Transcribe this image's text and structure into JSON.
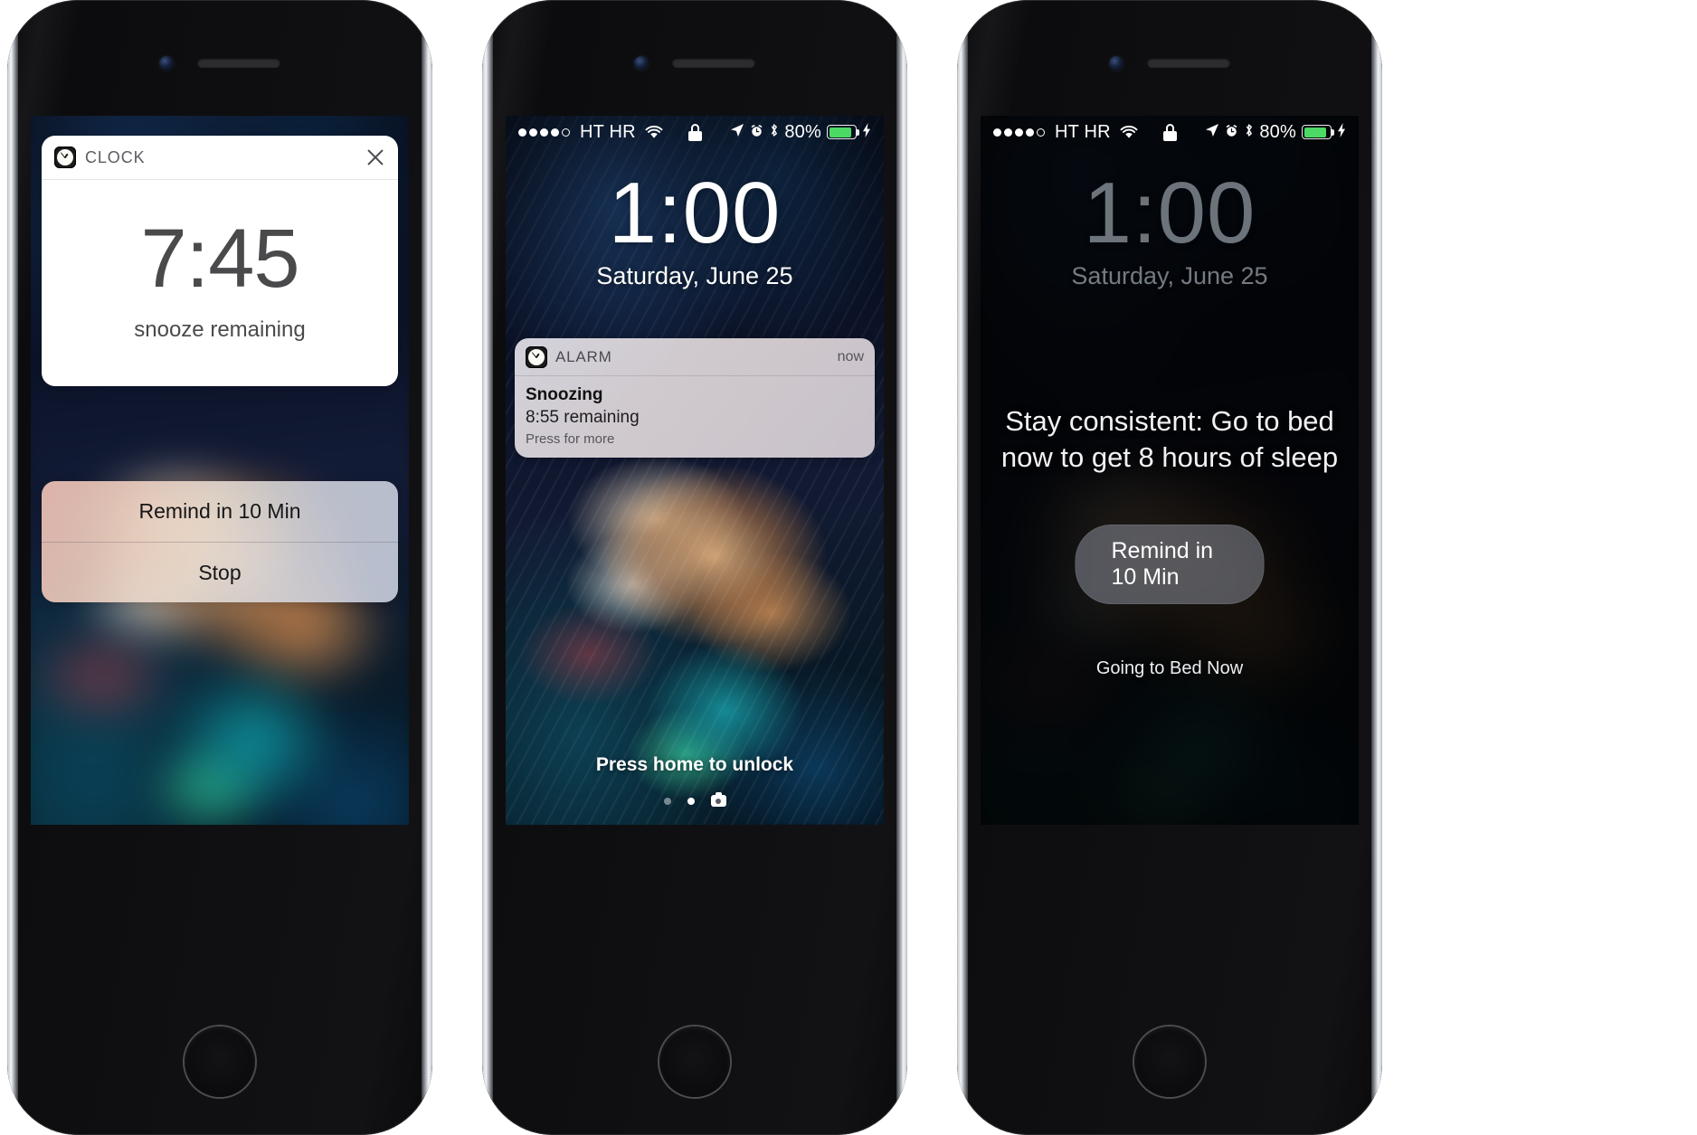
{
  "phones": [
    {
      "id": "phone-left",
      "variant": "expanded-notification",
      "notification_card": {
        "app_label": "CLOCK",
        "app_icon": "clock-icon",
        "close_icon": "close-x-icon",
        "time": "7:45",
        "subtitle": "snooze remaining"
      },
      "actions": [
        {
          "label": "Remind in 10 Min"
        },
        {
          "label": "Stop"
        }
      ]
    },
    {
      "id": "phone-center",
      "variant": "lock-screen-banner",
      "status_bar": {
        "signal_dots_filled": 4,
        "signal_dots_total": 5,
        "carrier": "HT HR",
        "wifi_icon": "wifi-icon",
        "lock_icon": "lock-icon",
        "location_icon": "location-arrow-icon",
        "alarm_icon": "alarm-clock-icon",
        "bluetooth_icon": "bluetooth-icon",
        "battery_percent": "80%",
        "battery_fill": 80,
        "charging_icon": "lightning-bolt-icon",
        "battery_color": "#4cd964"
      },
      "lock": {
        "time": "1:00",
        "date": "Saturday, June 25",
        "unlock_hint": "Press home to unlock"
      },
      "banner": {
        "app_label": "ALARM",
        "app_icon": "clock-icon",
        "timestamp": "now",
        "title": "Snoozing",
        "subtitle": "8:55 remaining",
        "hint": "Press for more"
      },
      "page_dots": {
        "count": 2,
        "active_index": 1,
        "camera_icon": "camera-icon"
      }
    },
    {
      "id": "phone-right",
      "variant": "bedtime-dimmed",
      "status_bar": {
        "signal_dots_filled": 4,
        "signal_dots_total": 5,
        "carrier": "HT HR",
        "wifi_icon": "wifi-icon",
        "lock_icon": "lock-icon",
        "location_icon": "location-arrow-icon",
        "alarm_icon": "alarm-clock-icon",
        "bluetooth_icon": "bluetooth-icon",
        "battery_percent": "80%",
        "battery_fill": 80,
        "charging_icon": "lightning-bolt-icon",
        "battery_color": "#4cd964"
      },
      "lock": {
        "time": "1:00",
        "date": "Saturday, June 25"
      },
      "bedtime": {
        "message": "Stay consistent: Go to bed now to get 8 hours of sleep",
        "remind_button": "Remind in 10 Min",
        "going_to_bed": "Going to Bed Now"
      }
    }
  ]
}
